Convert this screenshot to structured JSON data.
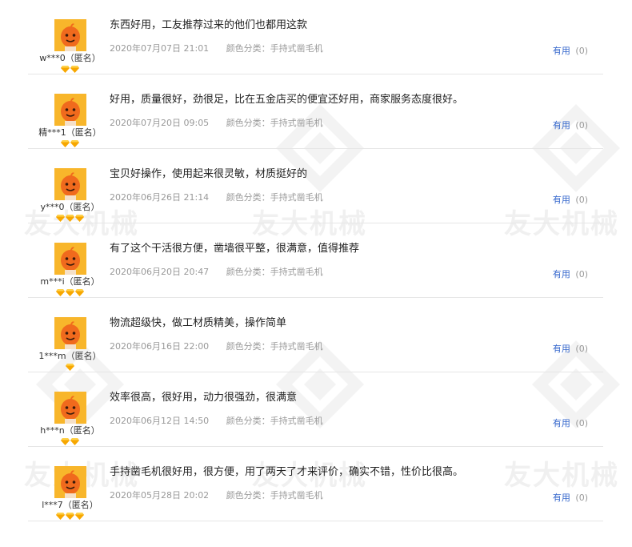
{
  "watermark": {
    "text": "友大机械"
  },
  "reviews": [
    {
      "user": "w***0（匿名）",
      "gems": 2,
      "text": "东西好用，工友推荐过来的他们也都用这款",
      "date": "2020年07月07日 21:01",
      "sku": "颜色分类：手持式凿毛机",
      "useful_label": "有用",
      "useful_count": "(0)"
    },
    {
      "user": "精***1（匿名）",
      "gems": 2,
      "text": "好用，质量很好，劲很足，比在五金店买的便宜还好用，商家服务态度很好。",
      "date": "2020年07月20日 09:05",
      "sku": "颜色分类：手持式凿毛机",
      "useful_label": "有用",
      "useful_count": "(0)"
    },
    {
      "user": "y***0（匿名）",
      "gems": 3,
      "text": "宝贝好操作，使用起来很灵敏，材质挺好的",
      "date": "2020年06月26日 21:14",
      "sku": "颜色分类：手持式凿毛机",
      "useful_label": "有用",
      "useful_count": "(0)"
    },
    {
      "user": "m***i（匿名）",
      "gems": 3,
      "text": "有了这个干活很方便，凿墙很平整，很满意，值得推荐",
      "date": "2020年06月20日 20:47",
      "sku": "颜色分类：手持式凿毛机",
      "useful_label": "有用",
      "useful_count": "(0)"
    },
    {
      "user": "1***m（匿名）",
      "gems": 1,
      "text": "物流超级快，做工材质精美，操作简单",
      "date": "2020年06月16日 22:00",
      "sku": "颜色分类：手持式凿毛机",
      "useful_label": "有用",
      "useful_count": "(0)"
    },
    {
      "user": "h***n（匿名）",
      "gems": 2,
      "text": "效率很高，很好用，动力很强劲，很满意",
      "date": "2020年06月12日 14:50",
      "sku": "颜色分类：手持式凿毛机",
      "useful_label": "有用",
      "useful_count": "(0)"
    },
    {
      "user": "l***7（匿名）",
      "gems": 3,
      "text": "手持凿毛机很好用，很方便，用了两天了才来评价，确实不错，性价比很高。",
      "date": "2020年05月28日 20:02",
      "sku": "颜色分类：手持式凿毛机",
      "useful_label": "有用",
      "useful_count": "(0)"
    }
  ]
}
